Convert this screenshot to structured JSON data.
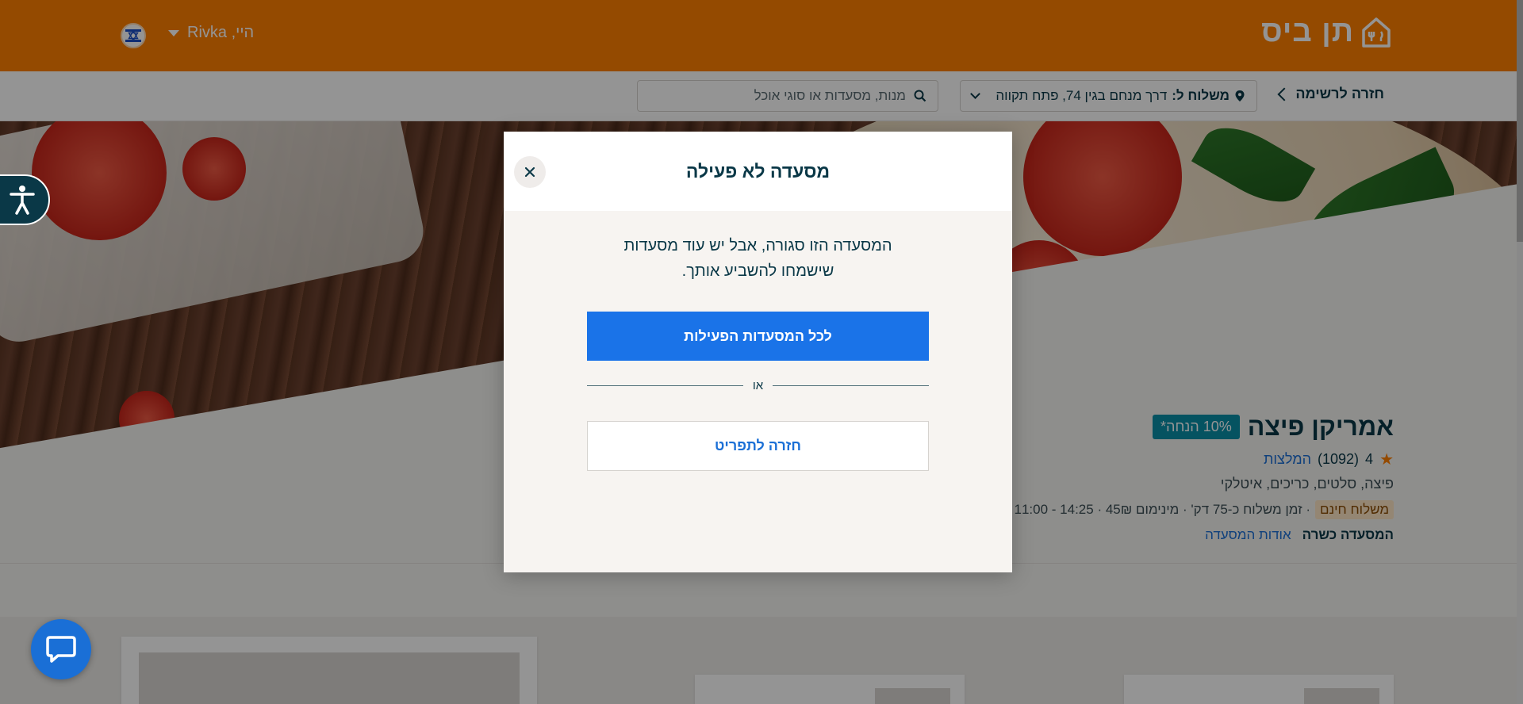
{
  "header": {
    "logo_text": "תן ביס",
    "user_greeting": "היי, Rivka"
  },
  "subbar": {
    "back_label": "חזרה לרשימה",
    "delivery_label": "משלוח ל:",
    "delivery_address": "דרך מנחם בגין 74, פתח תקווה",
    "search_placeholder": "מנות, מסעדות או סוגי אוכל"
  },
  "restaurant": {
    "name": "אמריקן פיצה",
    "discount_badge": "10% הנחה*",
    "rating": "4",
    "reviews_count": "(1092)",
    "reviews_link": "המלצות",
    "cuisines": "פיצה, סלטים, כריכים, איטלקי",
    "free_delivery": "משלוח חינם",
    "delivery_meta": "· זמן משלוח כ-75 דק' · מינימום 45₪ · 14:25 - 11:00",
    "kosher": "המסעדה כשרה",
    "about_link": "אודות המסעדה"
  },
  "modal": {
    "title": "מסעדה לא פעילה",
    "message_line1": "המסעדה הזו סגורה, אבל יש עוד מסעדות",
    "message_line2": "שישמחו להשביע אותך.",
    "primary_button": "לכל המסעדות הפעילות",
    "or_text": "או",
    "secondary_button": "חזרה לתפריט"
  },
  "colors": {
    "brand_orange": "#ff8000",
    "primary_blue": "#1a73e8",
    "dark_text": "#0a3847",
    "discount_teal": "#0a8fa8"
  },
  "icons": {
    "logo": "fork-knife-logo-icon",
    "flag": "israel-flag-icon",
    "location": "location-pin-icon",
    "search": "search-icon",
    "close": "close-icon",
    "accessibility": "accessibility-icon",
    "chat": "chat-bubble-icon",
    "star": "star-icon"
  }
}
